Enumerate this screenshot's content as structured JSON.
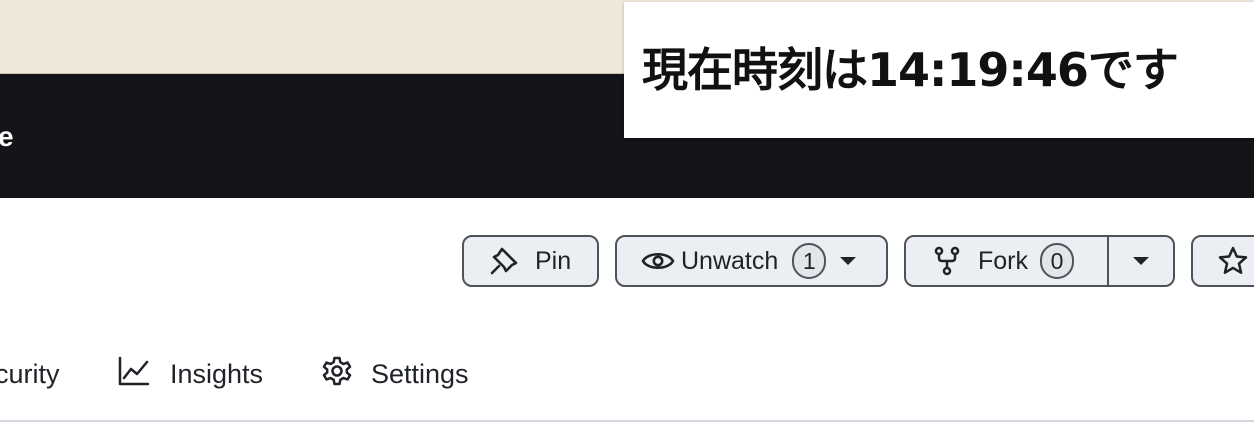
{
  "header": {
    "fragment": "e"
  },
  "overlay": {
    "time_text": "現在時刻は14:19:46です"
  },
  "repo_actions": {
    "pin_label": "Pin",
    "unwatch_label": "Unwatch",
    "watch_count": "1",
    "fork_label": "Fork",
    "fork_count": "0"
  },
  "tabs": [
    {
      "label": "curity",
      "icon": null
    },
    {
      "label": "Insights",
      "icon": "graph-icon"
    },
    {
      "label": "Settings",
      "icon": "gear-icon"
    }
  ],
  "colors": {
    "banner_bg": "#efe8d8",
    "header_bg": "#131418",
    "button_bg": "#ebeef2",
    "button_border": "#4d5359"
  }
}
